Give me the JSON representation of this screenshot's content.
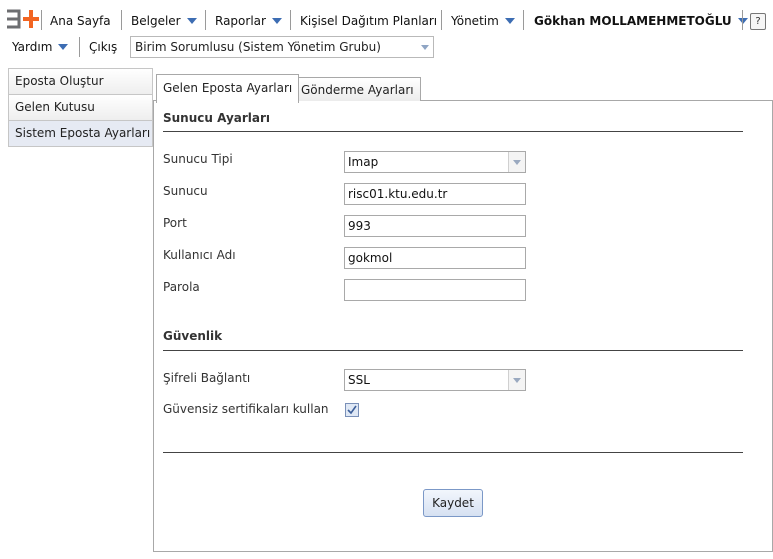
{
  "menu": {
    "home": "Ana Sayfa",
    "documents": "Belgeler",
    "reports": "Raporlar",
    "personal_plans": "Kişisel Dağıtım Planları",
    "management": "Yönetim",
    "user": "Gökhan MOLLAMEHMETOĞLU",
    "help_icon": "?",
    "help": "Yardım",
    "logout": "Çıkış",
    "role": "Birim Sorumlusu (Sistem Yönetim Grubu)"
  },
  "sidebar": {
    "items": [
      {
        "label": "Eposta Oluştur"
      },
      {
        "label": "Gelen Kutusu"
      },
      {
        "label": "Sistem Eposta Ayarları"
      }
    ]
  },
  "tabs": [
    {
      "label": "Gelen Eposta Ayarları"
    },
    {
      "label": "Gönderme Ayarları"
    }
  ],
  "server": {
    "section_title": "Sunucu Ayarları",
    "type_label": "Sunucu Tipi",
    "type_value": "Imap",
    "host_label": "Sunucu",
    "host_value": "risc01.ktu.edu.tr",
    "port_label": "Port",
    "port_value": "993",
    "username_label": "Kullanıcı Adı",
    "username_value": "gokmol",
    "password_label": "Parola",
    "password_value": ""
  },
  "security": {
    "section_title": "Güvenlik",
    "encrypted_label": "Şifreli Bağlantı",
    "encrypted_value": "SSL",
    "insecure_cert_label": "Güvensiz sertifikaları kullan",
    "insecure_cert_checked": true
  },
  "actions": {
    "save": "Kaydet"
  },
  "colors": {
    "accent_orange": "#f26522",
    "logo_gray": "#6d6e71",
    "dropdown_arrow": "#3d6db3"
  }
}
